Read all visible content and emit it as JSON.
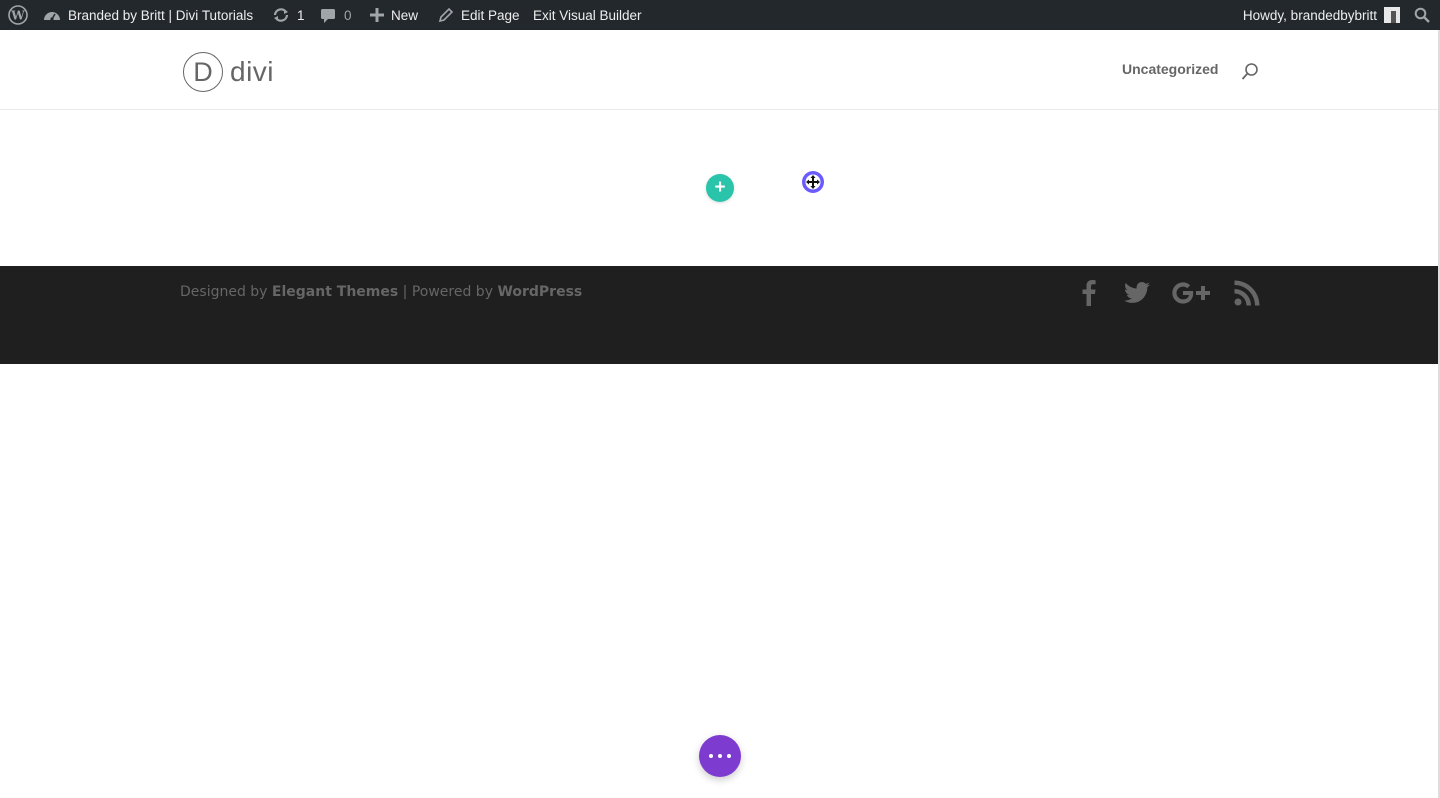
{
  "admin_bar": {
    "site_name": "Branded by Britt | Divi Tutorials",
    "updates_count": "1",
    "comments_count": "0",
    "new_label": "New",
    "edit_page_label": "Edit Page",
    "exit_builder_label": "Exit Visual Builder",
    "howdy_label": "Howdy, brandedbybritt"
  },
  "header": {
    "logo_letter": "D",
    "logo_text": "divi",
    "nav_items": [
      "Uncategorized"
    ]
  },
  "footer": {
    "designed_by": "Designed by",
    "theme_name": "Elegant Themes",
    "separator": "| Powered by",
    "platform": "WordPress",
    "social_icons": [
      "facebook-icon",
      "twitter-icon",
      "google-plus-icon",
      "rss-icon"
    ]
  },
  "colors": {
    "admin_bar_bg": "#23282d",
    "add_module_button": "#29c4a9",
    "page_settings_button": "#7e3bd0",
    "footer_bg": "#1f1f1f"
  }
}
